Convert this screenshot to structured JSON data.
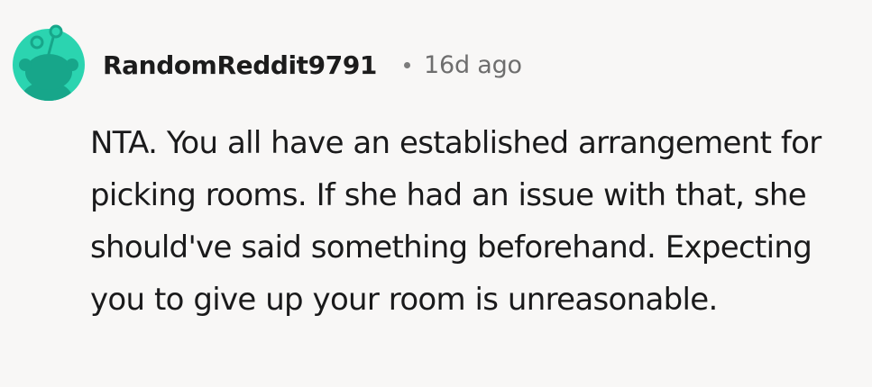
{
  "comment": {
    "avatar": {
      "icon": "reddit-snoo-avatar-icon",
      "background_color": "#2bd4b0",
      "figure_color": "#17a68a"
    },
    "author": "RandomReddit9791",
    "separator": "•",
    "timestamp": "16d ago",
    "body": "NTA. You all have an established arrangement for picking rooms. If she had an issue with that, she should've said something beforehand. Expecting you to give up your room is unreasonable."
  }
}
